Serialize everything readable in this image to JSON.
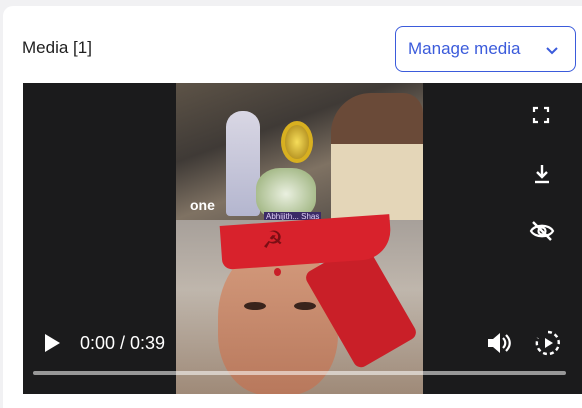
{
  "header": {
    "title": "Media [1]",
    "manage_label": "Manage media"
  },
  "player": {
    "time_display": "0:00 / 0:39",
    "progress": 0,
    "overlay_logo": "one",
    "overlay_caption": "Abhijith... Shas"
  },
  "icons": {
    "fullscreen": "fullscreen-icon",
    "download": "download-icon",
    "hide": "eye-off-icon",
    "play": "play-icon",
    "volume": "volume-icon",
    "speed": "playback-speed-icon",
    "dropdown": "chevron-down-icon"
  },
  "colors": {
    "accent": "#3b5bdb",
    "player_bg": "#1b1b1c",
    "page_bg": "#f1f1f3"
  }
}
